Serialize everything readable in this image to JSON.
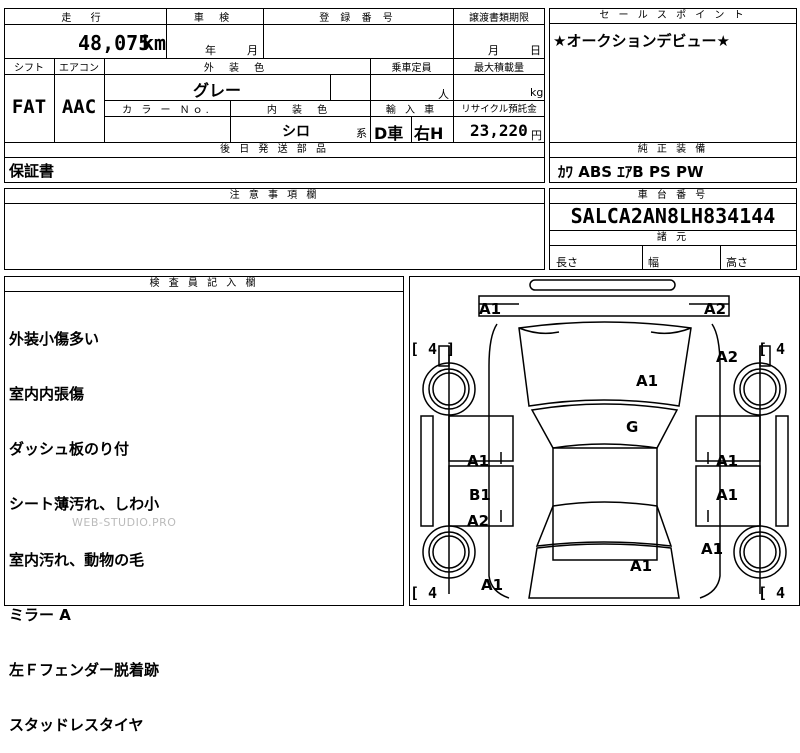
{
  "top_fields": {
    "mileage_label": "走 行",
    "mileage_value": "48,075",
    "mileage_unit": "km",
    "shaken_label": "車 検",
    "shaken_year": "年",
    "shaken_month": "月",
    "reg_label": "登 録 番 号",
    "transfer_label": "譲渡書類期限",
    "transfer_month": "月",
    "transfer_day": "日"
  },
  "sales_point": {
    "label": "セ ー ル ス ポ イ ン ト",
    "text": "★オークションデビュー★"
  },
  "row2": {
    "shift_label": "シフト",
    "shift_value": "FAT",
    "ac_label": "エアコン",
    "ac_value": "AAC",
    "exterior_label": "外 装 色",
    "exterior_value": "グレー",
    "capacity_label": "乗車定員",
    "capacity_unit": "人",
    "load_label": "最大積載量",
    "load_unit": "kg",
    "color_no_label": "カ ラ ー Ｎｏ.",
    "interior_label": "内 装 色",
    "interior_value": "シロ",
    "interior_suffix": "系",
    "import_label": "輸 入 車",
    "import_value_1": "D車",
    "import_value_2": "右H",
    "recycle_label": "リサイクル預託金",
    "recycle_value": "23,220",
    "recycle_unit": "円"
  },
  "later_parts": {
    "label": "後 日 発 送 部 品",
    "text": "保証書"
  },
  "standard_equipment": {
    "label": "純 正 装 備",
    "text": "ｶﾜ ABS ｴｱB PS PW"
  },
  "caution": {
    "label": "注 意 事 項 欄"
  },
  "chassis": {
    "label": "車 台 番 号",
    "value": "SALCA2AN8LH834144",
    "dims_label": "諸 元",
    "length_label": "長さ",
    "width_label": "幅",
    "height_label": "高さ"
  },
  "inspector": {
    "label": "検 査 員 記 入 欄",
    "notes": [
      "外装小傷多い",
      "室内内張傷",
      "ダッシュ板のり付",
      "シート薄汚れ、しわ小",
      "室内汚れ、動物の毛",
      "ミラー A",
      "左Ｆフェンダー脱着跡",
      "スタッドレスタイヤ"
    ]
  },
  "watermark": "WEB-STUDIO.PRO",
  "diagram": {
    "marks": {
      "front_left": "A1",
      "front_right": "A2",
      "right_front_fender": "A2",
      "hood": "A1",
      "windshield": "G",
      "left_front_door": "A1",
      "right_front_door": "A1",
      "left_pillar": "B1",
      "right_rear_door": "A1",
      "left_rear_door": "A2",
      "right_rear_fender": "A1",
      "roof_rear": "A1",
      "rear_left": "A1"
    },
    "tires": {
      "front_left": "[ 4 ]",
      "front_right": "[ 4",
      "rear_left": "[ 4",
      "rear_right": "[ 4"
    }
  }
}
